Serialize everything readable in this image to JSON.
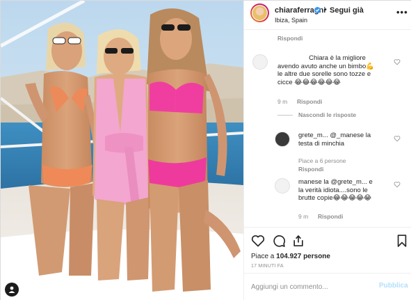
{
  "post": {
    "username": "chiaraferragni",
    "separator": "•",
    "follow_label": "Segui già",
    "location": "Ibiza, Spain",
    "more_label": "•••"
  },
  "comments": {
    "ghost_reply": "Rispondi",
    "items": [
      {
        "text_lines": [
          "Chiara è la migliore",
          "avendo avuto anche un bimbo💪",
          "le altre due sorelle sono tozze e",
          "cicce 😂😂😂😂😂😂"
        ],
        "time": "9 m",
        "reply_label": "Rispondi",
        "hide_label": "Nascondi le risposte"
      },
      {
        "text_lines": [
          "grete_m... @_manese la",
          "testa di minchia"
        ],
        "likes": "Piace a 6 persone",
        "reply_label": "Rispondi"
      },
      {
        "text_lines": [
          "manese la @grete_m... e",
          "la verità idiota....sono le",
          "brutte copie😂😂😂😂😂"
        ],
        "time": "9 m",
        "reply_label": "Rispondi"
      }
    ]
  },
  "actions": {
    "likes_prefix": "Piace a",
    "likes_count": "104.927",
    "likes_suffix": "persone",
    "timestamp": "17 MINUTI FA",
    "icons": [
      "heart-icon",
      "comment-icon",
      "share-icon",
      "bookmark-icon"
    ]
  },
  "composer": {
    "placeholder": "Aggiungi un commento...",
    "publish_label": "Pubblica"
  },
  "colors": {
    "accent": "#3897f0",
    "publish_disabled": "#b2dffc",
    "muted": "#8e8e8e",
    "text": "#262626"
  }
}
